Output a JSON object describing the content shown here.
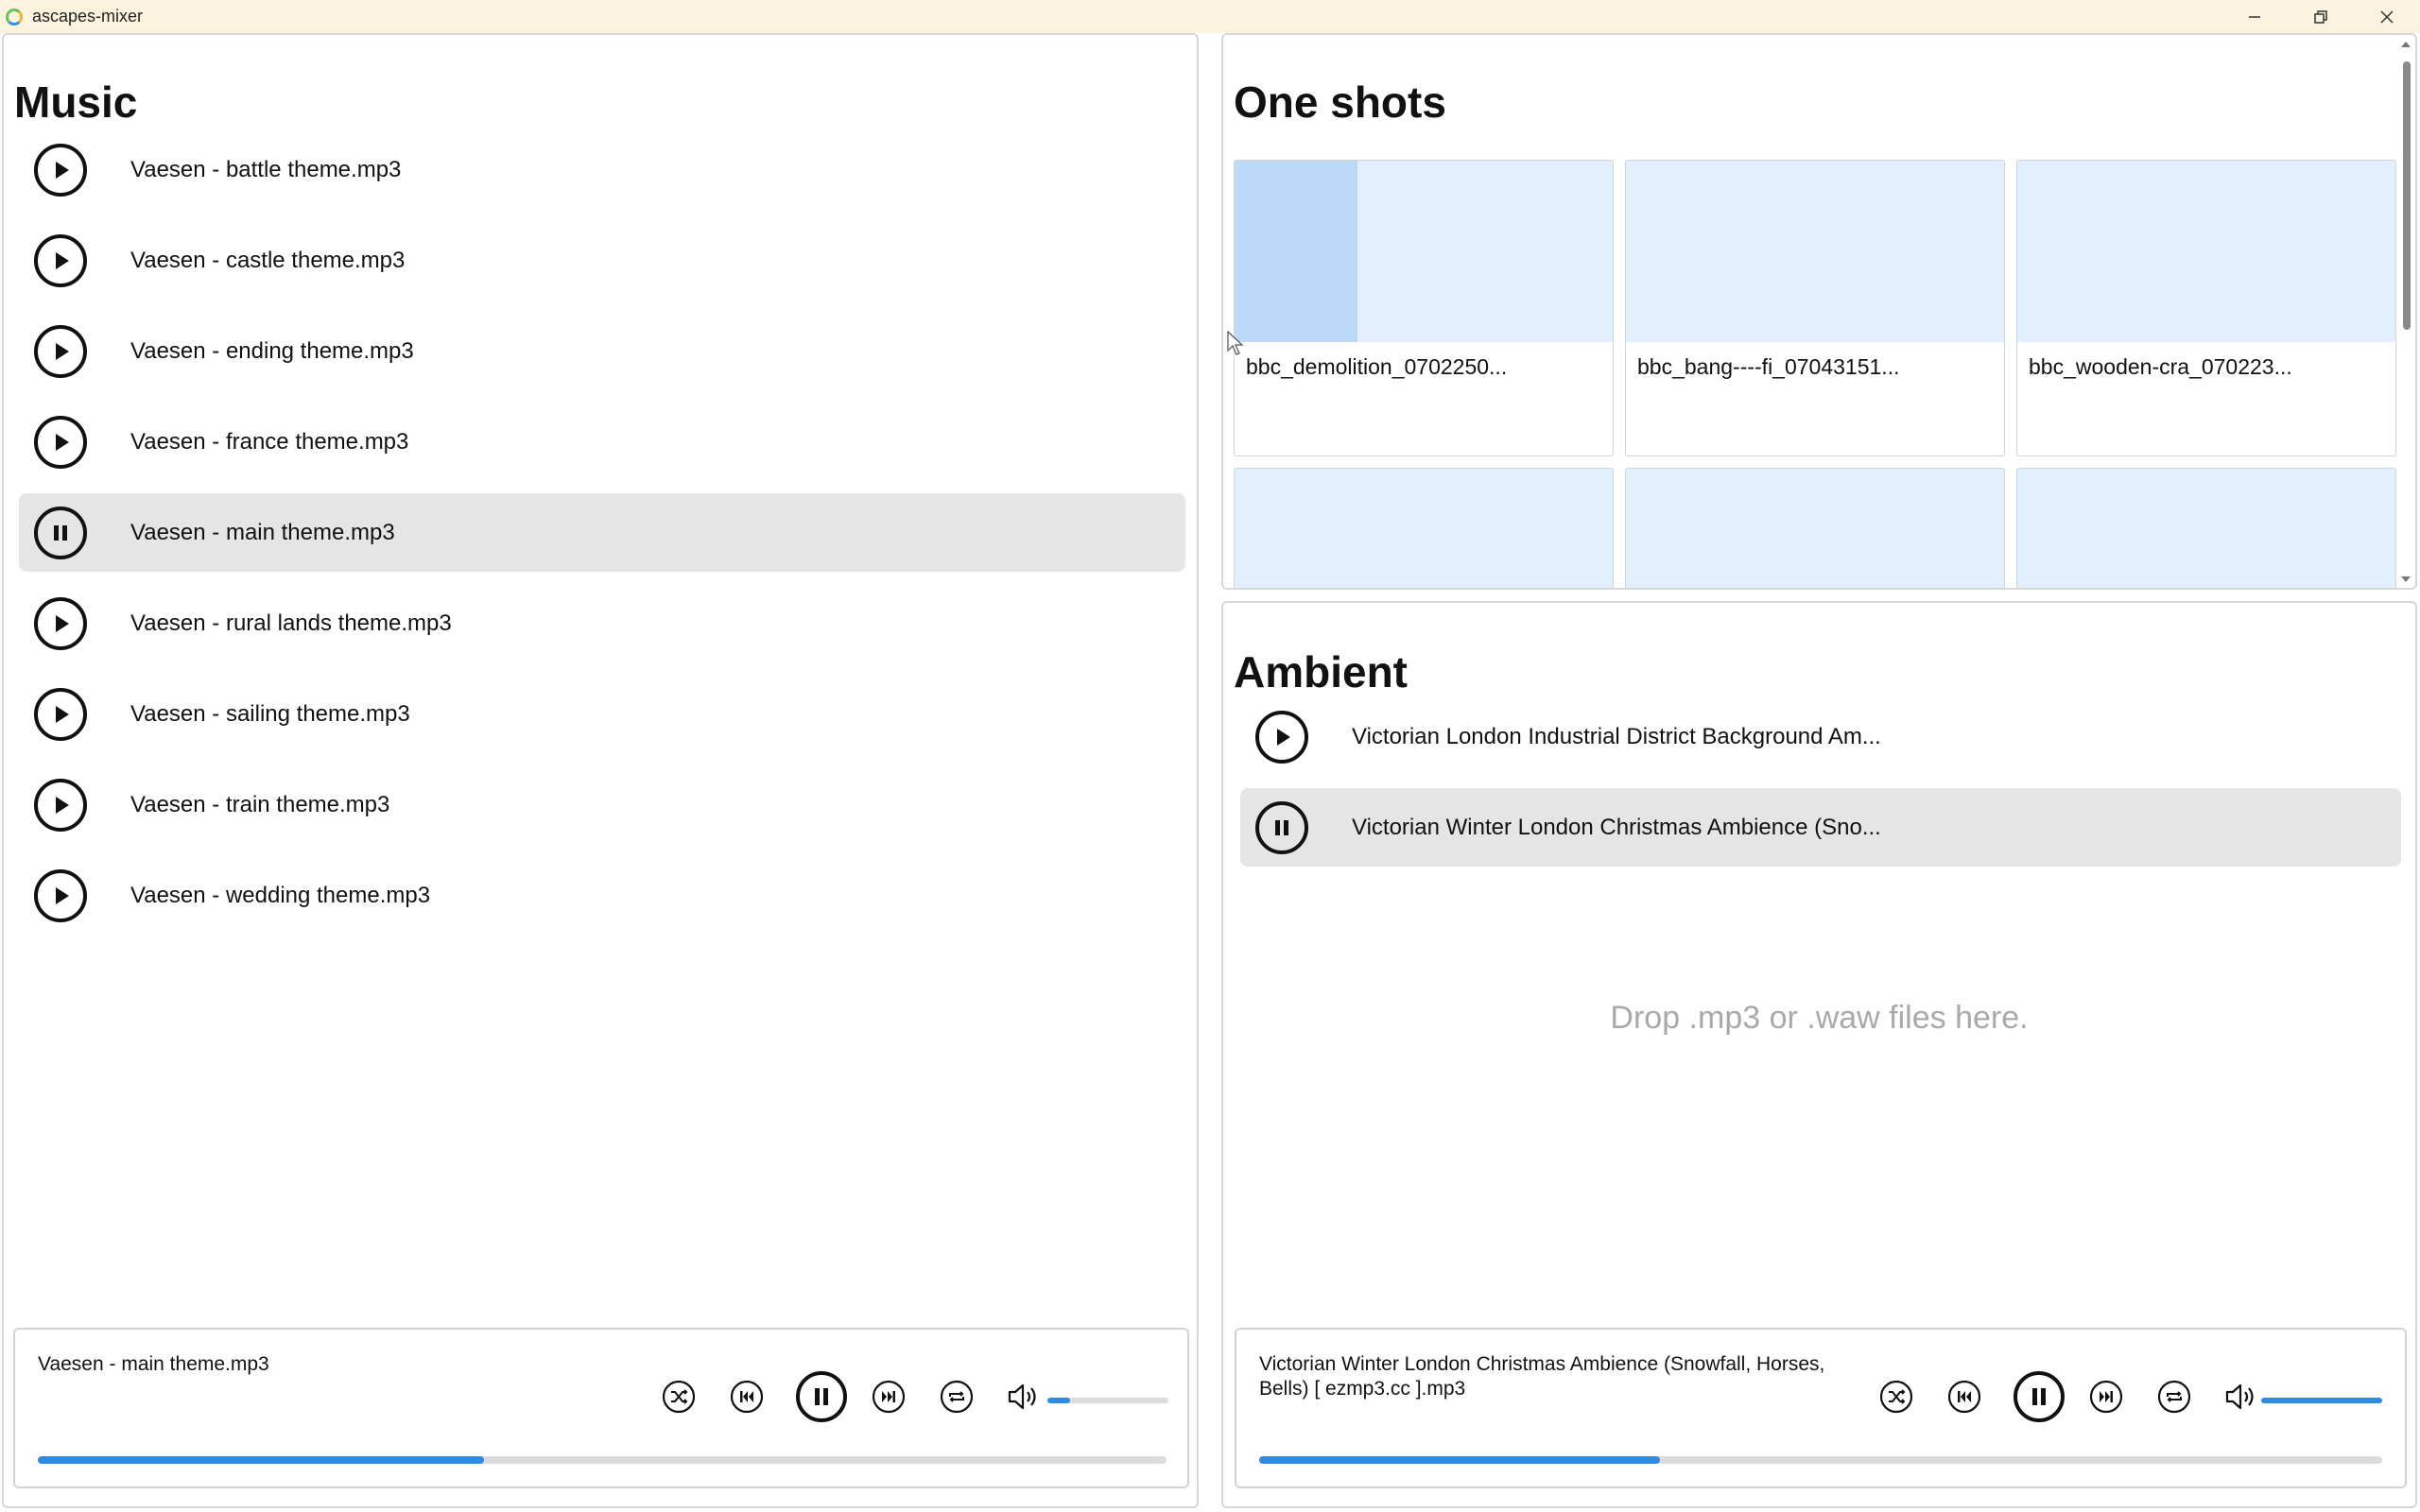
{
  "window": {
    "title": "ascapes-mixer"
  },
  "music": {
    "heading": "Music",
    "tracks": [
      {
        "label": "Vaesen - battle theme.mp3",
        "state": "play"
      },
      {
        "label": "Vaesen - castle theme.mp3",
        "state": "play"
      },
      {
        "label": "Vaesen - ending theme.mp3",
        "state": "play"
      },
      {
        "label": "Vaesen - france theme.mp3",
        "state": "play"
      },
      {
        "label": "Vaesen - main theme.mp3",
        "state": "pause"
      },
      {
        "label": "Vaesen - rural lands theme.mp3",
        "state": "play"
      },
      {
        "label": "Vaesen - sailing theme.mp3",
        "state": "play"
      },
      {
        "label": "Vaesen - train theme.mp3",
        "state": "play"
      },
      {
        "label": "Vaesen - wedding theme.mp3",
        "state": "play"
      }
    ],
    "player": {
      "title": "Vaesen - main theme.mp3",
      "volume": 0.19,
      "progress": 0.395
    }
  },
  "oneshots": {
    "heading": "One shots",
    "items": [
      {
        "label": "bbc_demolition_0702250...",
        "progress": 0.325
      },
      {
        "label": "bbc_bang----fi_07043151...",
        "progress": 0
      },
      {
        "label": "bbc_wooden-cra_070223...",
        "progress": 0
      },
      {
        "label": "",
        "progress": 0
      },
      {
        "label": "",
        "progress": 0
      },
      {
        "label": "",
        "progress": 0
      }
    ]
  },
  "ambient": {
    "heading": "Ambient",
    "tracks": [
      {
        "label": "Victorian London Industrial District Background Am...",
        "state": "play"
      },
      {
        "label": "Victorian Winter London Christmas Ambience (Sno...",
        "state": "pause"
      }
    ],
    "drop_hint": "Drop .mp3 or .waw files here.",
    "player": {
      "title": "Victorian Winter London Christmas Ambience (Snowfall, Horses, Bells) [ ezmp3.cc ].mp3",
      "volume": 1.0,
      "progress": 0.357
    }
  },
  "colors": {
    "accent": "#2f8ae0",
    "active_row": "#e5e5e5",
    "tile_bg": "#e2f0fd",
    "tile_progress": "#bcdaf7",
    "titlebar": "#fbf3de"
  }
}
